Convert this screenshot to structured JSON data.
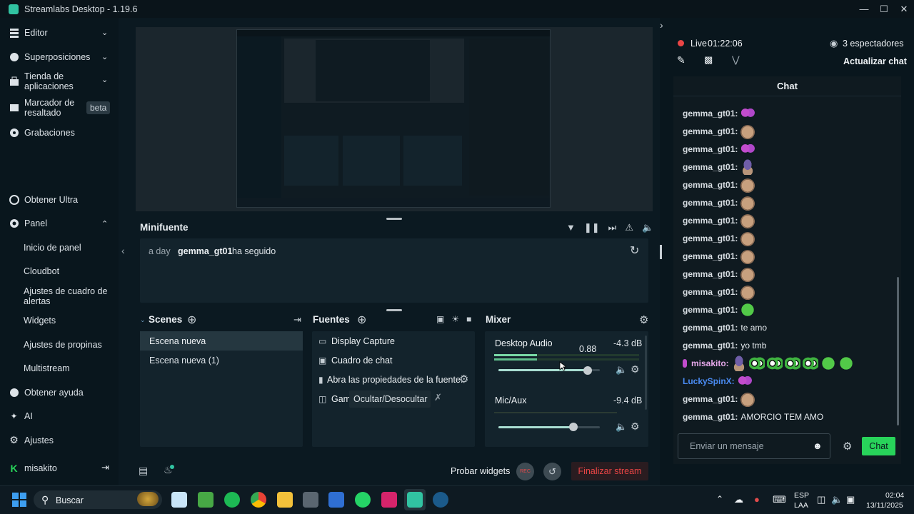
{
  "window": {
    "title": "Streamlabs Desktop - 1.19.6"
  },
  "sidebar": {
    "items": [
      {
        "label": "Editor",
        "icon": "editor-icon"
      },
      {
        "label": "Superposiciones",
        "icon": "overlay-icon"
      },
      {
        "label": "Tienda de aplicaciones",
        "icon": "store-icon"
      },
      {
        "label": "Marcador de resaltado",
        "icon": "highlighter-icon",
        "badge": "beta"
      },
      {
        "label": "Grabaciones",
        "icon": "recordings-icon"
      },
      {
        "label": "Obtener Ultra",
        "icon": "ultra-icon"
      },
      {
        "label": "Panel",
        "icon": "dashboard-icon"
      },
      {
        "label": "Obtener ayuda",
        "icon": "help-icon"
      },
      {
        "label": "AI",
        "icon": "ai-icon"
      },
      {
        "label": "Ajustes",
        "icon": "settings-icon"
      }
    ],
    "panel_subitems": [
      "Inicio de panel",
      "Cloudbot",
      "Ajustes de cuadro de alertas",
      "Widgets",
      "Ajustes de propinas",
      "Multistream"
    ],
    "user": "misakito"
  },
  "minifeed": {
    "title": "Minifuente",
    "event": {
      "time": "a day",
      "user": "gemma_gt01",
      "action": "ha seguido"
    }
  },
  "scenes": {
    "title": "Scenes",
    "items": [
      "Escena nueva",
      "Escena nueva (1)"
    ]
  },
  "sources": {
    "title": "Fuentes",
    "items": [
      "Display Capture",
      "Cuadro de chat",
      "Abra las propiedades de la fuente.",
      "Gam"
    ],
    "tooltip": "Ocultar/Desocultar"
  },
  "mixer": {
    "title": "Mixer",
    "channels": [
      {
        "name": "Desktop Audio",
        "db": "-4.3 dB",
        "tooltip": "0.88",
        "level": 0.88
      },
      {
        "name": "Mic/Aux",
        "db": "-9.4 dB",
        "level": 0.74
      }
    ]
  },
  "footer": {
    "test_widgets": "Probar widgets",
    "rec": "REC",
    "end_stream": "Finalizar stream"
  },
  "live": {
    "status": "Live",
    "time": "01:22:06",
    "viewers": "3 espectadores",
    "refresh_chat": "Actualizar chat"
  },
  "chat": {
    "title": "Chat",
    "messages": [
      {
        "user": "gemma_gt01:",
        "text": "",
        "emotes": [
          "bfly"
        ]
      },
      {
        "user": "gemma_gt01:",
        "text": "",
        "emotes": [
          "cat"
        ]
      },
      {
        "user": "gemma_gt01:",
        "text": "",
        "emotes": [
          "bfly"
        ]
      },
      {
        "user": "gemma_gt01:",
        "text": "",
        "emotes": [
          "hat"
        ]
      },
      {
        "user": "gemma_gt01:",
        "text": "",
        "emotes": [
          "cat"
        ]
      },
      {
        "user": "gemma_gt01:",
        "text": "",
        "emotes": [
          "cat"
        ]
      },
      {
        "user": "gemma_gt01:",
        "text": "",
        "emotes": [
          "cat"
        ]
      },
      {
        "user": "gemma_gt01:",
        "text": "",
        "emotes": [
          "cat"
        ]
      },
      {
        "user": "gemma_gt01:",
        "text": "",
        "emotes": [
          "cat"
        ]
      },
      {
        "user": "gemma_gt01:",
        "text": "",
        "emotes": [
          "cat"
        ]
      },
      {
        "user": "gemma_gt01:",
        "text": "",
        "emotes": [
          "cat"
        ]
      },
      {
        "user": "gemma_gt01:",
        "text": "",
        "emotes": [
          "green"
        ]
      },
      {
        "user": "gemma_gt01:",
        "text": "te amo",
        "emotes": []
      },
      {
        "user": "gemma_gt01:",
        "text": "yo tmb",
        "emotes": []
      },
      {
        "user": "misakito:",
        "text": "",
        "emotes": [
          "hat",
          "eyes",
          "eyes",
          "eyes",
          "eyes",
          "green",
          "green"
        ],
        "color": "#e6a8ea"
      },
      {
        "user": "LuckySpinX:",
        "text": "",
        "emotes": [
          "bfly"
        ],
        "color": "#4a8bf2"
      },
      {
        "user": "gemma_gt01:",
        "text": "",
        "emotes": [
          "cat"
        ]
      },
      {
        "user": "gemma_gt01:",
        "text": "AMORCIO TEM AMO",
        "emotes": []
      }
    ],
    "input_placeholder": "Enviar un mensaje",
    "send_label": "Chat"
  },
  "taskbar": {
    "search": "Buscar",
    "lang": "ESP",
    "lang2": "LAA",
    "time": "02:04",
    "date": "13/11/2025"
  },
  "colors": {
    "accent": "#31c3a2",
    "live": "#ea4545",
    "send": "#28d35a"
  }
}
